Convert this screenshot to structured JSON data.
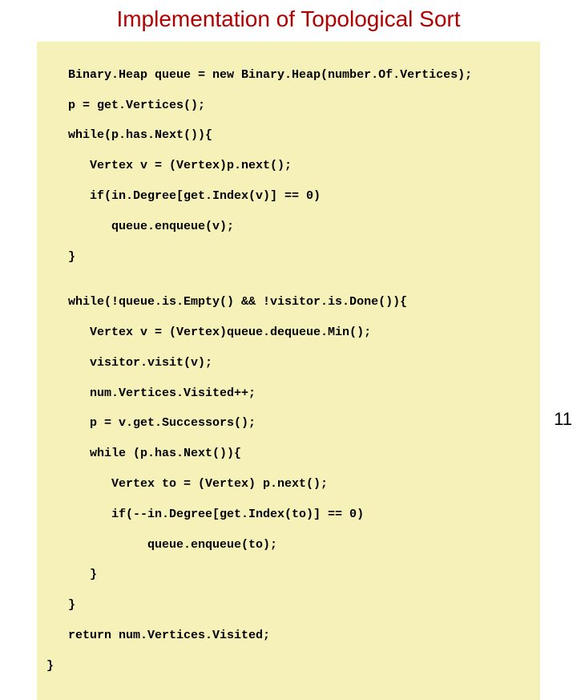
{
  "title": "Implementation of Topological Sort",
  "page_number": "11",
  "code": {
    "l01": "   Binary.Heap queue = new Binary.Heap(number.Of.Vertices);",
    "l02": "   p = get.Vertices();",
    "l03": "   while(p.has.Next()){",
    "l04": "      Vertex v = (Vertex)p.next();",
    "l05": "      if(in.Degree[get.Index(v)] == 0)",
    "l06": "         queue.enqueue(v);",
    "l07": "   }",
    "l08": "",
    "l09": "   while(!queue.is.Empty() && !visitor.is.Done()){",
    "l10": "      Vertex v = (Vertex)queue.dequeue.Min();",
    "l11": "      visitor.visit(v);",
    "l12": "      num.Vertices.Visited++;",
    "l13": "      p = v.get.Successors();",
    "l14": "      while (p.has.Next()){",
    "l15": "         Vertex to = (Vertex) p.next();",
    "l16": "         if(--in.Degree[get.Index(to)] == 0)",
    "l17": "              queue.enqueue(to);",
    "l18": "      }",
    "l19": "   }",
    "l20": "   return num.Vertices.Visited;",
    "l21": "}"
  }
}
